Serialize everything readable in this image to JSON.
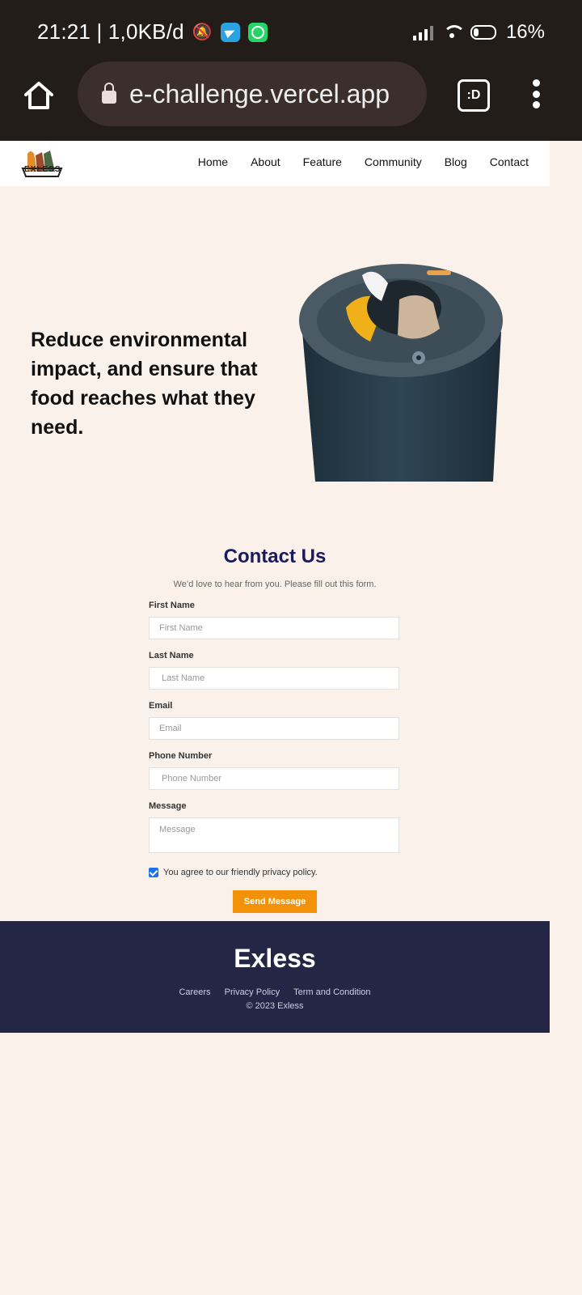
{
  "status_bar": {
    "time_info": "21:21 | 1,0KB/d",
    "battery": "16%"
  },
  "browser": {
    "url_text": "e-challenge.vercel.app",
    "tab_label": ":D"
  },
  "site": {
    "logo_text": "EXLESS",
    "nav": [
      "Home",
      "About",
      "Feature",
      "Community",
      "Blog",
      "Contact"
    ],
    "hero_text": "Reduce environmental impact, and ensure that food reaches what they need.",
    "contact": {
      "title": "Contact Us",
      "subtitle": "We’d love to hear from you. Please fill out this form.",
      "first_name_label": "First Name",
      "first_name_placeholder": "First Name",
      "last_name_label": "Last Name",
      "last_name_placeholder": "Last Name",
      "email_label": "Email",
      "email_placeholder": "Email",
      "phone_label": "Phone Number",
      "phone_placeholder": "Phone Number",
      "message_label": "Message",
      "message_placeholder": "Message",
      "agree_text": "You agree to our friendly privacy policy.",
      "send_label": "Send Message"
    },
    "footer": {
      "brand": "Exless",
      "links": [
        "Careers",
        "Privacy Policy",
        "Term and Condition"
      ],
      "copyright": "© 2023 Exless"
    }
  },
  "colors": {
    "page_bg": "#f9f1ea",
    "chrome_bg": "#231d1a",
    "accent_orange": "#f39208",
    "title_navy": "#1a1b5a",
    "footer_bg": "#232645"
  },
  "icons": [
    "telegram-icon",
    "whatsapp-icon",
    "signal-icon",
    "wifi-icon",
    "battery-icon",
    "home-icon",
    "lock-icon",
    "more-vert-icon"
  ]
}
